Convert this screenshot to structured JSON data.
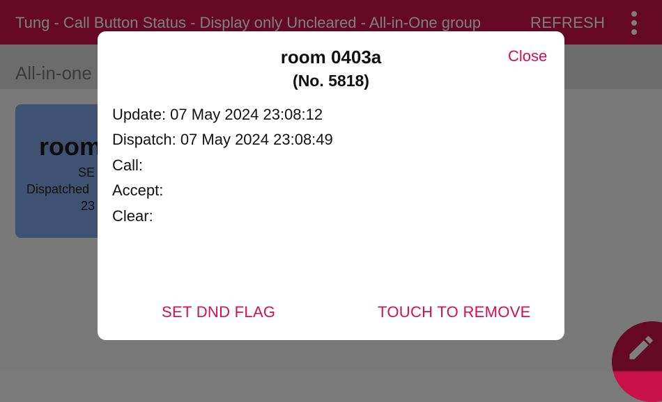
{
  "appbar": {
    "title": "Tung - Call Button Status - Display only Uncleared - All-in-One group",
    "refresh_label": "REFRESH",
    "menu_icon": "more-vert-icon"
  },
  "subbar": {
    "group_label": "All-in-one"
  },
  "card": {
    "room": "room",
    "status": "SE",
    "dispatched": "Dispatched",
    "time": "23"
  },
  "fab": {
    "icon": "pencil-icon"
  },
  "dialog": {
    "title": "room 0403a",
    "number": "(No. 5818)",
    "close_label": "Close",
    "fields": {
      "update": "Update: 07 May 2024 23:08:12",
      "dispatch": "Dispatch: 07 May 2024 23:08:49",
      "call": "Call:",
      "accept": "Accept:",
      "clear": "Clear:"
    },
    "actions": {
      "set_dnd": "SET DND FLAG",
      "touch_remove": "TOUCH TO REMOVE"
    }
  },
  "colors": {
    "brand": "#c8104a",
    "accent_text": "#d3104e",
    "card_blue": "#7ea4e4"
  }
}
